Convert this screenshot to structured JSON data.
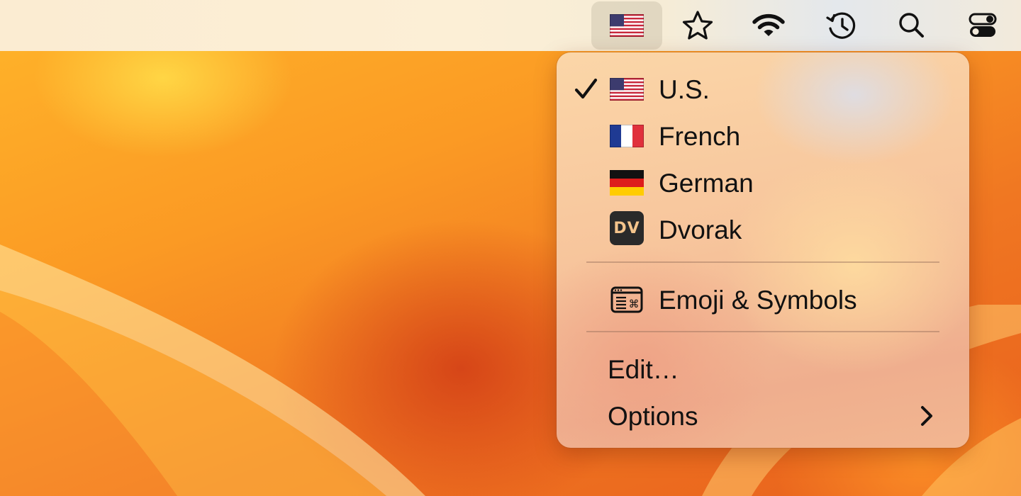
{
  "menubar": {
    "icons": [
      "us-flag-icon",
      "star-icon",
      "wifi-icon",
      "history-icon",
      "search-icon",
      "control-center-icon"
    ]
  },
  "input_menu": {
    "items": [
      {
        "label": "U.S.",
        "icon": "us-flag-icon",
        "checked": true
      },
      {
        "label": "French",
        "icon": "france-flag-icon",
        "checked": false
      },
      {
        "label": "German",
        "icon": "germany-flag-icon",
        "checked": false
      },
      {
        "label": "Dvorak",
        "icon": "dvorak-badge-icon",
        "badge_text": "DV",
        "checked": false
      }
    ],
    "emoji_label": "Emoji & Symbols",
    "edit_label": "Edit…",
    "options_label": "Options"
  }
}
